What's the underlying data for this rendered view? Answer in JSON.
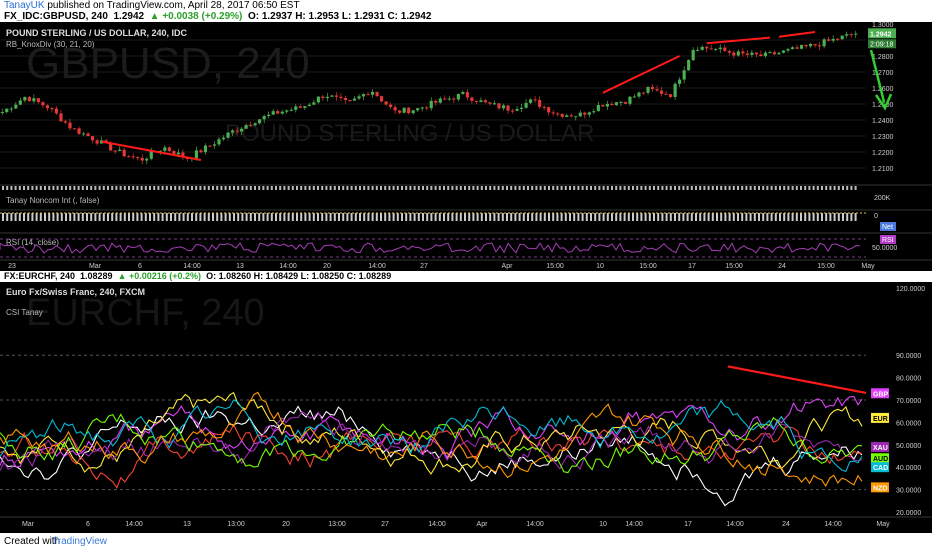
{
  "header": {
    "author": "TanayUK",
    "published": "published on TradingView.com, April 28, 2017 06:50 EST",
    "symbol": "FX_IDC:GBPUSD, 240",
    "last": "1.2942",
    "change": "▲ +0.0038 (+0.29%)",
    "ohlc": "O: 1.2937  H: 1.2953  L: 1.2931  C: 1.2942"
  },
  "footer": {
    "created": "Created with",
    "brand": "TradingView"
  },
  "panel2_header": {
    "symbol": "FX:EURCHF, 240",
    "last": "1.08289",
    "change": "▲ +0.00216 (+0.2%)",
    "ohlc": "O: 1.08260  H: 1.08429  L: 1.08250  C: 1.08289"
  },
  "colors": {
    "up": "#2ca02c",
    "bull": "#4caf50",
    "bear": "#e53935",
    "trend": "#ff1a1a",
    "arrow": "#33cc33",
    "GBP": "#e040fb",
    "EUR": "#ffeb3b",
    "XAU": "#9c27b0",
    "AUD": "#76ff03",
    "CAD": "#00bcd4",
    "NZD": "#ff9800",
    "USD": "#ffffff",
    "JPY": "#f44336"
  },
  "chart_data": [
    {
      "type": "candlestick",
      "title": "POUND STERLING / US DOLLAR, 240, IDC",
      "indicator": "RB_KnoxDiv (30, 21, 20)",
      "watermark_symbol": "GBPUSD, 240",
      "watermark_name": "POUND STERLING / US DOLLAR",
      "ylim": [
        1.2,
        1.3
      ],
      "y_ticks": [
        "1.3000",
        "1.2800",
        "1.2700",
        "1.2600",
        "1.2500",
        "1.2400",
        "1.2300",
        "1.2200",
        "1.2100"
      ],
      "last_price_label": "1.2942",
      "countdown_label": "2:09:18",
      "x_ticks": [
        "23",
        "Mar",
        "6",
        "14:00",
        "13",
        "14:00",
        "20",
        "14:00",
        "27",
        "Apr",
        "15:00",
        "10",
        "15:00",
        "17",
        "15:00",
        "24",
        "15:00",
        "May"
      ],
      "close_path": [
        1.245,
        1.2545,
        1.248,
        1.235,
        1.228,
        1.22,
        1.215,
        1.223,
        1.216,
        1.224,
        1.233,
        1.24,
        1.245,
        1.248,
        1.256,
        1.25,
        1.259,
        1.245,
        1.247,
        1.252,
        1.256,
        1.25,
        1.247,
        1.252,
        1.244,
        1.243,
        1.25,
        1.252,
        1.259,
        1.256,
        1.286,
        1.284,
        1.281,
        1.28,
        1.283,
        1.286,
        1.29,
        1.2942
      ],
      "divergence_lines": 4
    },
    {
      "type": "bar",
      "title": "Tanay Noncom Int (, false)",
      "y_ticks": [
        "200K",
        "0"
      ],
      "badge": "Net"
    },
    {
      "type": "line",
      "title": "RSI (14, close)",
      "badge": "RSI",
      "y_ticks": [
        "50.0000"
      ]
    },
    {
      "type": "line",
      "title": "Euro Fx/Swiss Franc, 240, FXCM",
      "indicator": "CSI Tanay",
      "watermark_symbol": "EURCHF, 240",
      "ylim": [
        20,
        120
      ],
      "y_ticks": [
        "120.0000",
        "90.0000",
        "80.0000",
        "70.0000",
        "60.0000",
        "50.0000",
        "40.0000",
        "30.0000",
        "20.0000"
      ],
      "x_ticks": [
        "Mar",
        "6",
        "14:00",
        "13",
        "13:00",
        "20",
        "13:00",
        "27",
        "14:00",
        "Apr",
        "14:00",
        "10",
        "14:00",
        "17",
        "14:00",
        "24",
        "14:00",
        "May"
      ],
      "series": [
        {
          "name": "GBP",
          "last": 73
        },
        {
          "name": "EUR",
          "last": 62
        },
        {
          "name": "XAU",
          "last": 49
        },
        {
          "name": "AUD",
          "last": 44
        },
        {
          "name": "CAD",
          "last": 40
        },
        {
          "name": "NZD",
          "last": 31
        }
      ],
      "trend_line": [
        85,
        73
      ]
    }
  ]
}
